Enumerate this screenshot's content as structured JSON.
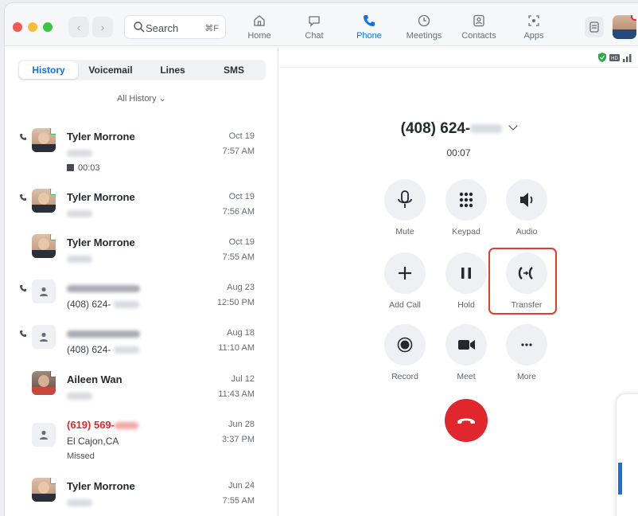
{
  "titlebar": {
    "search_placeholder": "Search",
    "search_shortcut": "⌘F",
    "tabs": [
      {
        "label": "Home",
        "icon": "home-icon"
      },
      {
        "label": "Chat",
        "icon": "chat-icon"
      },
      {
        "label": "Phone",
        "icon": "phone-icon",
        "active": true
      },
      {
        "label": "Meetings",
        "icon": "clock-icon"
      },
      {
        "label": "Contacts",
        "icon": "contacts-icon"
      },
      {
        "label": "Apps",
        "icon": "apps-icon"
      }
    ]
  },
  "history": {
    "segments": [
      "History",
      "Voicemail",
      "Lines",
      "SMS"
    ],
    "active_segment": "History",
    "filter": "All History",
    "items": [
      {
        "name": "Tyler Morrone",
        "date": "Oct 19",
        "time": "7:57 AM",
        "voicemail": "00:03"
      },
      {
        "name": "Tyler Morrone",
        "date": "Oct 19",
        "time": "7:56 AM"
      },
      {
        "name": "Tyler Morrone",
        "date": "Oct 19",
        "time": "7:55 AM"
      },
      {
        "number_prefix": "(408) 624-",
        "date": "Aug 23",
        "time": "12:50 PM"
      },
      {
        "number_prefix": "(408) 624-",
        "date": "Aug 18",
        "time": "11:10 AM"
      },
      {
        "name": "Aileen Wan",
        "date": "Jul 12",
        "time": "11:43 AM"
      },
      {
        "name_prefix": "(619) 569-",
        "location": "El Cajon,CA",
        "status": "Missed",
        "date": "Jun 28",
        "time": "3:37 PM"
      },
      {
        "name": "Tyler Morrone",
        "date": "Jun 24",
        "time": "7:55 AM"
      }
    ]
  },
  "call": {
    "number_prefix": "(408) 624-",
    "duration": "00:07",
    "controls": [
      "Mute",
      "Keypad",
      "Audio",
      "Add Call",
      "Hold",
      "Transfer",
      "Record",
      "Meet",
      "More"
    ]
  },
  "colors": {
    "accent": "#0e72ed",
    "end_call": "#e0272d",
    "missed": "#e02828",
    "highlight": "#e23d2d"
  }
}
